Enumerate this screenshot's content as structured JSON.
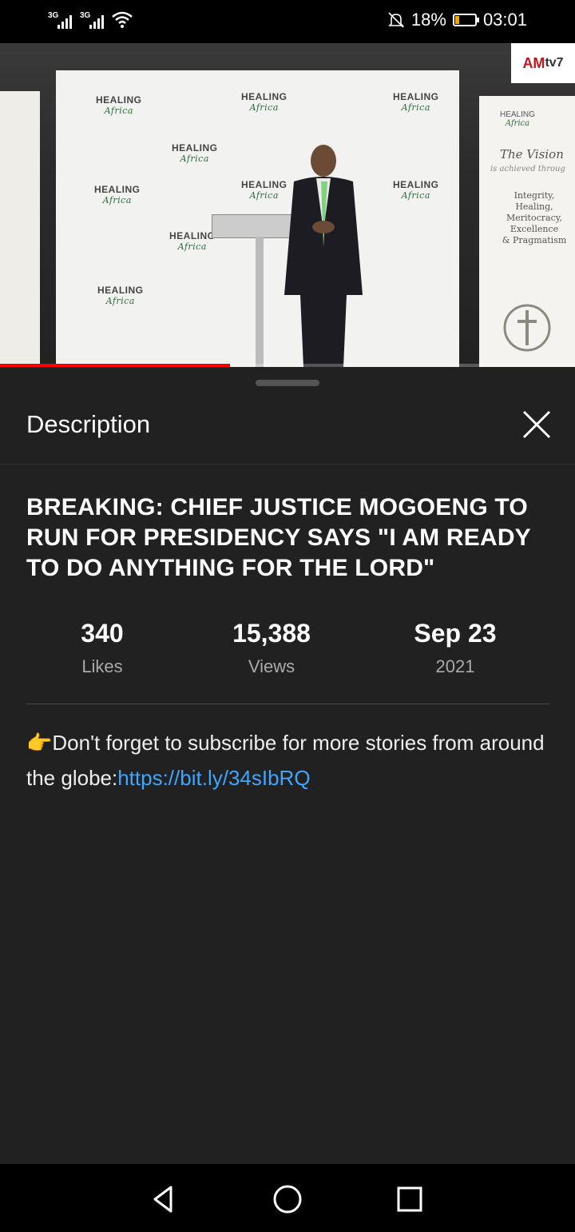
{
  "status_bar": {
    "sim1": "3G",
    "sim2": "3G",
    "battery": "18%",
    "time": "03:01",
    "battery_level": 0.18
  },
  "video": {
    "channel_logo_a": "AM",
    "channel_logo_b": "tv7",
    "backdrop_logo_line1": "HEALING",
    "backdrop_logo_line2": "Africa",
    "side_banner_heading": "The Vision",
    "side_banner_sub": "is achieved throug",
    "side_banner_values": [
      "Integrity,",
      "Healing,",
      "Meritocracy,",
      "Excellence",
      "& Pragmatism"
    ],
    "progress": 0.4
  },
  "description_panel": {
    "header": "Description",
    "title": "BREAKING: CHIEF JUSTICE MOGOENG TO RUN FOR PRESIDENCY SAYS \"I AM READY TO DO ANYTHING FOR THE LORD\"",
    "stats": {
      "likes_value": "340",
      "likes_label": "Likes",
      "views_value": "15,388",
      "views_label": "Views",
      "date_value": "Sep 23",
      "date_label": "2021"
    },
    "description_prefix": "👉Don't forget to subscribe  for more  stories from around the globe:",
    "description_link": "https://bit.ly/34sIbRQ"
  },
  "colors": {
    "panel_bg": "#212121",
    "link": "#3ea6ff",
    "progress": "#ff0000"
  }
}
